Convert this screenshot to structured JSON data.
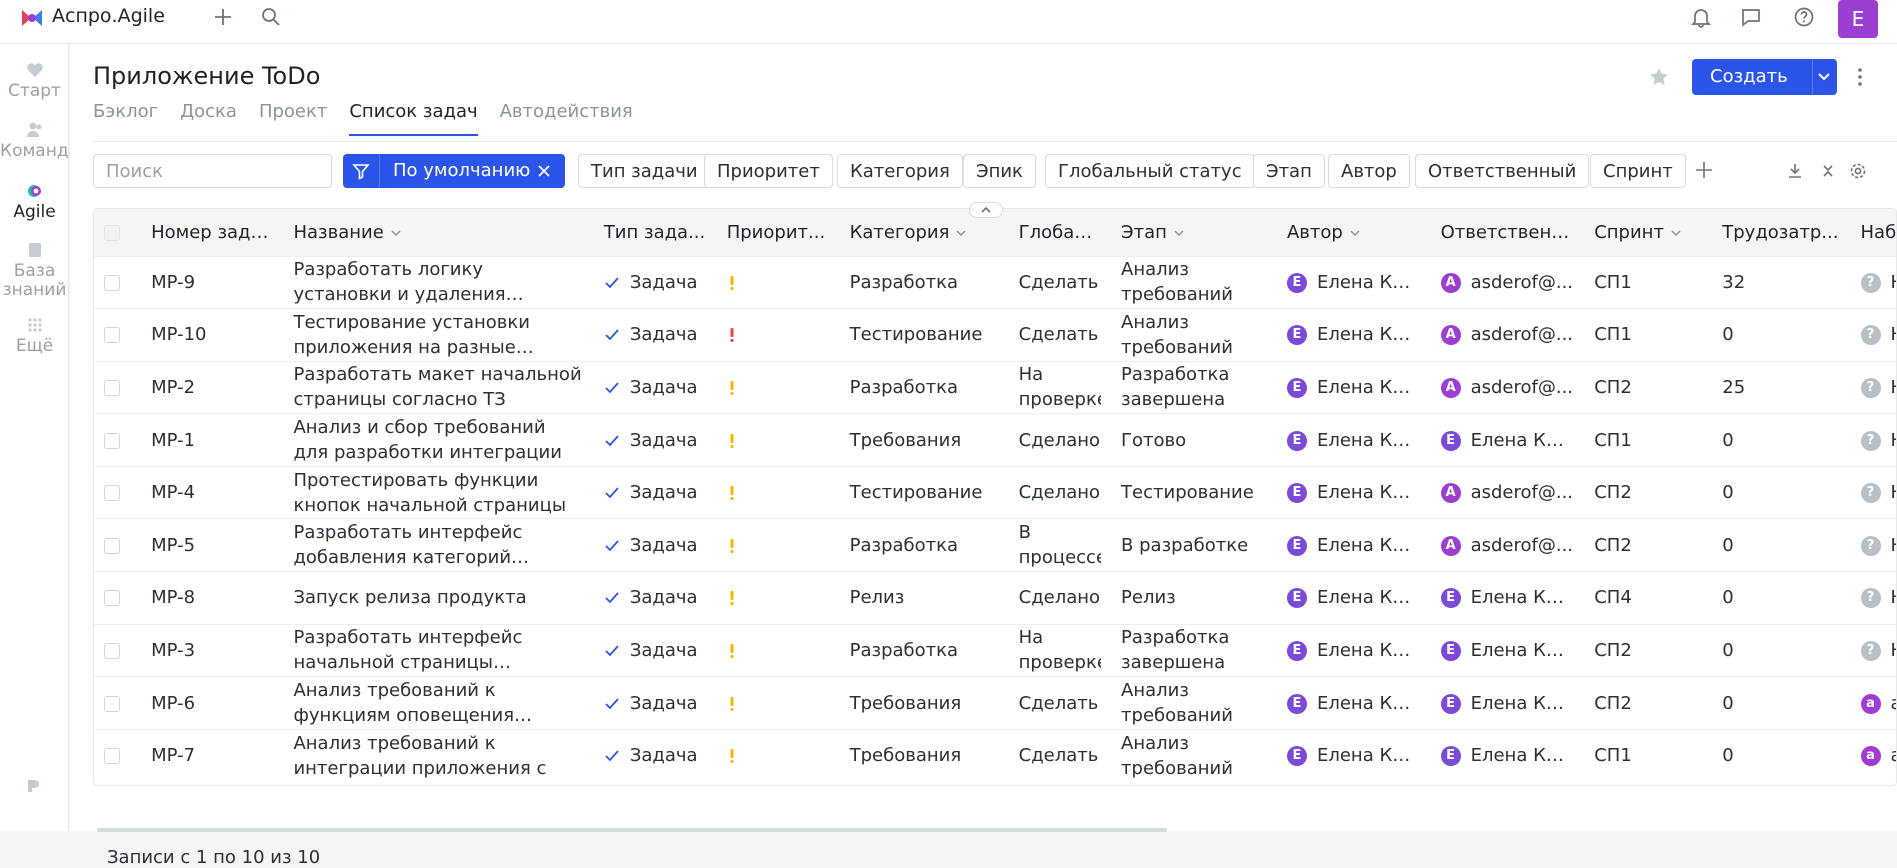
{
  "app": {
    "name": "Аспро.Agile",
    "avatar_letter": "E",
    "brand_colors": [
      "#e8415b",
      "#3f7bf0",
      "#22c3a4",
      "#9c3fd0"
    ]
  },
  "sidebar": {
    "items": [
      {
        "label": "Старт",
        "icon": "heart-icon"
      },
      {
        "label": "Команда",
        "icon": "team-icon"
      },
      {
        "label": "Agile",
        "icon": "agile-icon"
      },
      {
        "label": "База знаний",
        "icon": "book-icon"
      },
      {
        "label": "Ещё",
        "icon": "grid-icon"
      }
    ]
  },
  "page": {
    "title": "Приложение ToDo",
    "tabs": [
      "Бэклог",
      "Доска",
      "Проект",
      "Список задач",
      "Автодействия"
    ],
    "active_tab": "Список задач",
    "create_label": "Создать",
    "accent": "#2b55e8"
  },
  "filters": {
    "search_placeholder": "Поиск",
    "default_filter": "По умолчанию",
    "chips": [
      "Тип задачи",
      "Приоритет",
      "Категория",
      "Эпик",
      "Глобальный статус",
      "Этап",
      "Автор",
      "Ответственный",
      "Спринт"
    ]
  },
  "table": {
    "columns": [
      "Номер зада...",
      "Название",
      "Тип зада...",
      "Приорит...",
      "Категория",
      "Глобал...",
      "Этап",
      "Автор",
      "Ответственн...",
      "Спринт",
      "Трудозатр...",
      "Наблюд..."
    ],
    "rows": [
      {
        "id": "MP-9",
        "name": "Разработать логику установки и удаления приложения",
        "type": "Задача",
        "priority": "medium",
        "category": "Разработка",
        "global": "Сделать",
        "stage": "Анализ требований",
        "author": "Елена Кот...",
        "author_av": "E",
        "assignee": "asderof@...",
        "assignee_av": "A",
        "sprint": "СП1",
        "effort": "32",
        "watcher": "Не у",
        "watcher_av": "?"
      },
      {
        "id": "MP-10",
        "name": "Тестирование установки приложения на разные версии",
        "type": "Задача",
        "priority": "high",
        "category": "Тестирование",
        "global": "Сделать",
        "stage": "Анализ требований",
        "author": "Елена Кот...",
        "author_av": "E",
        "assignee": "asderof@...",
        "assignee_av": "A",
        "sprint": "СП1",
        "effort": "0",
        "watcher": "Не у",
        "watcher_av": "?"
      },
      {
        "id": "MP-2",
        "name": "Разработать макет начальной страницы согласно ТЗ",
        "type": "Задача",
        "priority": "medium",
        "category": "Разработка",
        "global": "На проверке",
        "stage": "Разработка завершена",
        "author": "Елена Кот...",
        "author_av": "E",
        "assignee": "asderof@...",
        "assignee_av": "A",
        "sprint": "СП2",
        "effort": "25",
        "watcher": "Не у",
        "watcher_av": "?"
      },
      {
        "id": "MP-1",
        "name": "Анализ и сбор требований для разработки интеграции",
        "type": "Задача",
        "priority": "medium",
        "category": "Требования",
        "global": "Сделано",
        "stage": "Готово",
        "author": "Елена Кот...",
        "author_av": "E",
        "assignee": "Елена Кот...",
        "assignee_av": "E",
        "sprint": "СП1",
        "effort": "0",
        "watcher": "Не у",
        "watcher_av": "?"
      },
      {
        "id": "MP-4",
        "name": "Протестировать функции кнопок начальной страницы",
        "type": "Задача",
        "priority": "medium",
        "category": "Тестирование",
        "global": "Сделано",
        "stage": "Тестирование",
        "author": "Елена Кот...",
        "author_av": "E",
        "assignee": "asderof@...",
        "assignee_av": "A",
        "sprint": "СП2",
        "effort": "0",
        "watcher": "Не у",
        "watcher_av": "?"
      },
      {
        "id": "MP-5",
        "name": "Разработать интерфейс добавления категорий согласно",
        "type": "Задача",
        "priority": "medium",
        "category": "Разработка",
        "global": "В процессе",
        "stage": "В разработке",
        "author": "Елена Кот...",
        "author_av": "E",
        "assignee": "asderof@...",
        "assignee_av": "A",
        "sprint": "СП2",
        "effort": "0",
        "watcher": "Не у",
        "watcher_av": "?"
      },
      {
        "id": "MP-8",
        "name": "Запуск релиза продукта",
        "type": "Задача",
        "priority": "medium",
        "category": "Релиз",
        "global": "Сделано",
        "stage": "Релиз",
        "author": "Елена Кот...",
        "author_av": "E",
        "assignee": "Елена Кот...",
        "assignee_av": "E",
        "sprint": "СП4",
        "effort": "0",
        "watcher": "Не у",
        "watcher_av": "?"
      },
      {
        "id": "MP-3",
        "name": "Разработать интерфейс начальной страницы согласно",
        "type": "Задача",
        "priority": "medium",
        "category": "Разработка",
        "global": "На проверке",
        "stage": "Разработка завершена",
        "author": "Елена Кот...",
        "author_av": "E",
        "assignee": "Елена Кот...",
        "assignee_av": "E",
        "sprint": "СП2",
        "effort": "0",
        "watcher": "Не у",
        "watcher_av": "?"
      },
      {
        "id": "MP-6",
        "name": "Анализ требований к функциям оповещения пользователя",
        "type": "Задача",
        "priority": "medium",
        "category": "Требования",
        "global": "Сделать",
        "stage": "Анализ требований",
        "author": "Елена Кот...",
        "author_av": "E",
        "assignee": "Елена Кот...",
        "assignee_av": "E",
        "sprint": "СП2",
        "effort": "0",
        "watcher": "asde",
        "watcher_av": "a"
      },
      {
        "id": "MP-7",
        "name": "Анализ требований к интеграции приложения с",
        "type": "Задача",
        "priority": "medium",
        "category": "Требования",
        "global": "Сделать",
        "stage": "Анализ требований",
        "author": "Елена Кот...",
        "author_av": "E",
        "assignee": "Елена Кот...",
        "assignee_av": "E",
        "sprint": "СП1",
        "effort": "0",
        "watcher": "asde",
        "watcher_av": "a"
      }
    ],
    "priority_colors": {
      "medium": "#f5b800",
      "high": "#e8453c"
    },
    "pager": "Записи с 1 по 10 из 10"
  }
}
